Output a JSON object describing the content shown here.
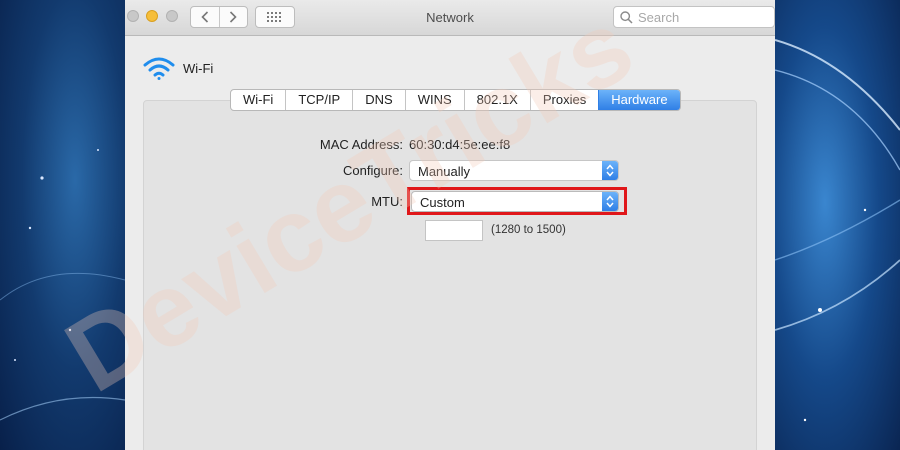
{
  "window": {
    "title": "Network",
    "search_placeholder": "Search"
  },
  "service": {
    "name": "Wi-Fi",
    "icon": "wifi-icon"
  },
  "tabs": [
    {
      "label": "Wi-Fi",
      "active": false
    },
    {
      "label": "TCP/IP",
      "active": false
    },
    {
      "label": "DNS",
      "active": false
    },
    {
      "label": "WINS",
      "active": false
    },
    {
      "label": "802.1X",
      "active": false
    },
    {
      "label": "Proxies",
      "active": false
    },
    {
      "label": "Hardware",
      "active": true
    }
  ],
  "hardware": {
    "mac_label": "MAC Address:",
    "mac_value": "60:30:d4:5e:ee:f8",
    "configure_label": "Configure:",
    "configure_value": "Manually",
    "mtu_label": "MTU:",
    "mtu_value": "Custom",
    "mtu_input_value": "",
    "mtu_range_hint": "(1280 to 1500)"
  },
  "watermark": {
    "text": "DeviceTricks"
  },
  "colors": {
    "accent": "#2f7fe6",
    "highlight": "#e0171a",
    "wifi": "#1f8ded",
    "watermark": "#f4c9b8"
  }
}
